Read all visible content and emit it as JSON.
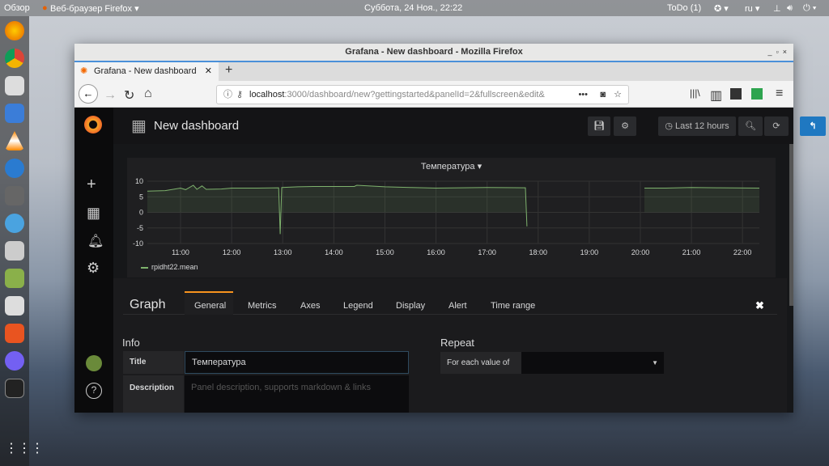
{
  "topbar": {
    "overview": "Обзор",
    "app": "Веб-браузер Firefox ▾",
    "clock": "Суббота, 24 Ноя., 22:22",
    "todo": "ToDo (1)",
    "lang": "ru ▾"
  },
  "window": {
    "title": "Grafana - New dashboard - Mozilla Firefox",
    "tab_title": "Grafana - New dashboard",
    "url_host": "localhost",
    "url_rest": ":3000/dashboard/new?gettingstarted&panelId=2&fullscreen&edit&"
  },
  "grafana": {
    "dashboard_title": "New dashboard",
    "time_range": "Last 12 hours",
    "panel": {
      "title": "Температура",
      "legend": "rpidht22.mean"
    },
    "editor": {
      "type": "Graph",
      "tabs": [
        "General",
        "Metrics",
        "Axes",
        "Legend",
        "Display",
        "Alert",
        "Time range"
      ],
      "info_heading": "Info",
      "title_label": "Title",
      "title_value": "Температура",
      "description_label": "Description",
      "description_placeholder": "Panel description, supports markdown & links",
      "repeat_heading": "Repeat",
      "repeat_label": "For each value of",
      "repeat_value": ""
    }
  },
  "colors": {
    "series": "#7eb26d",
    "accent": "#1f78c1"
  },
  "chart_data": {
    "type": "line",
    "title": "Температура",
    "ylim": [
      -10,
      10
    ],
    "yticks": [
      "10",
      "5",
      "0",
      "-5",
      "-10"
    ],
    "xlim": [
      10.35,
      22.33
    ],
    "xticks": [
      "11:00",
      "12:00",
      "13:00",
      "14:00",
      "15:00",
      "16:00",
      "17:00",
      "18:00",
      "19:00",
      "20:00",
      "21:00",
      "22:00"
    ],
    "series": [
      {
        "name": "rpidht22.mean",
        "fill": true,
        "points": [
          [
            10.35,
            6.8
          ],
          [
            10.7,
            7.0
          ],
          [
            11.0,
            7.8
          ],
          [
            11.1,
            7.3
          ],
          [
            11.25,
            8.7
          ],
          [
            11.32,
            7.4
          ],
          [
            11.42,
            8.5
          ],
          [
            11.5,
            7.4
          ],
          [
            11.8,
            7.5
          ],
          [
            12.0,
            7.8
          ],
          [
            12.5,
            7.8
          ],
          [
            12.92,
            7.9
          ],
          [
            12.95,
            -7
          ],
          [
            12.98,
            8.0
          ],
          [
            13.3,
            8.2
          ],
          [
            13.6,
            8.3
          ],
          [
            14.4,
            8.3
          ],
          [
            14.45,
            8.7
          ],
          [
            15.0,
            8.2
          ],
          [
            15.5,
            8.0
          ],
          [
            16.0,
            7.8
          ],
          [
            16.5,
            7.9
          ],
          [
            17.0,
            8.0
          ],
          [
            17.75,
            7.9
          ],
          [
            17.78,
            -4.5
          ],
          null,
          [
            20.08,
            7.8
          ],
          [
            20.5,
            7.8
          ],
          [
            21.0,
            8.0
          ],
          [
            21.5,
            7.9
          ],
          [
            22.33,
            7.8
          ]
        ]
      }
    ]
  }
}
